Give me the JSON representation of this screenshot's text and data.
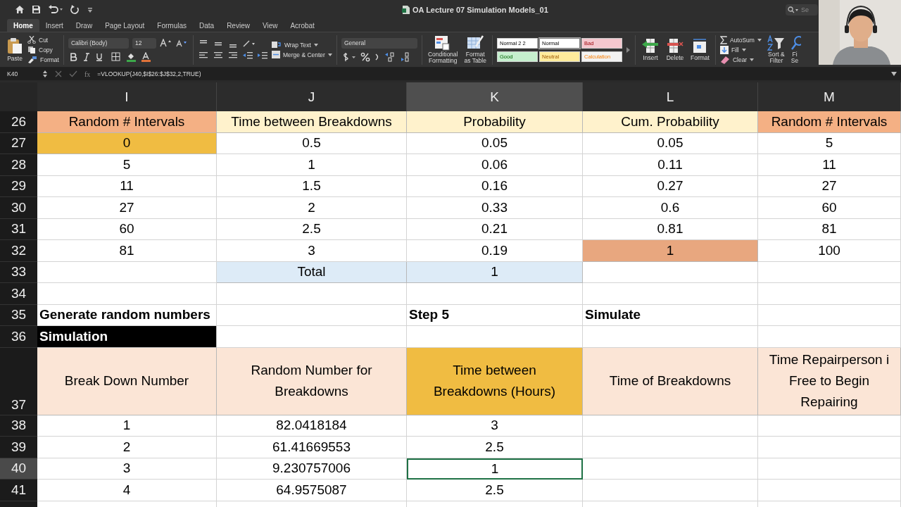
{
  "window": {
    "title": "OA Lecture 07 Simulation Models_01",
    "search_placeholder": "Se"
  },
  "tabs": [
    {
      "label": "Home",
      "selected": true
    },
    {
      "label": "Insert",
      "selected": false
    },
    {
      "label": "Draw",
      "selected": false
    },
    {
      "label": "Page Layout",
      "selected": false
    },
    {
      "label": "Formulas",
      "selected": false
    },
    {
      "label": "Data",
      "selected": false
    },
    {
      "label": "Review",
      "selected": false
    },
    {
      "label": "View",
      "selected": false
    },
    {
      "label": "Acrobat",
      "selected": false
    }
  ],
  "ribbon": {
    "paste": "Paste",
    "clipboard": [
      "Cut",
      "Copy",
      "Format"
    ],
    "font_family": "Calibri (Body)",
    "font_size": "12",
    "wrap": "Wrap Text",
    "merge": "Merge & Center",
    "number_format": "General",
    "format_buttons": [
      "Conditional\nFormatting",
      "Format\nas Table"
    ],
    "cell_styles": [
      {
        "label": "Normal 2 2",
        "kind": "normal",
        "color": "#ffffff",
        "selected": false
      },
      {
        "label": "Normal",
        "kind": "normal",
        "color": "#ffffff",
        "selected": true
      },
      {
        "label": "Bad",
        "kind": "bad",
        "color": "#f4c7ce",
        "selected": false
      },
      {
        "label": "Good",
        "kind": "good",
        "color": "#c6efce",
        "selected": false
      },
      {
        "label": "Neutral",
        "kind": "neutral",
        "color": "#ffeb9c",
        "selected": false
      },
      {
        "label": "Calculation",
        "kind": "calc",
        "color": "#f2f2f2",
        "selected": false
      }
    ],
    "cells": [
      "Insert",
      "Delete",
      "Format"
    ],
    "autosum": "AutoSum",
    "fill": "Fill",
    "clear": "Clear",
    "sort": "Sort &\nFilter",
    "find": "Fi\nSe"
  },
  "formula_bar": {
    "name_box": "K40",
    "fx": "fx",
    "formula": "=VLOOKUP(J40,$I$26:$J$32,2,TRUE)"
  },
  "columns": [
    {
      "label": "I",
      "selected": false
    },
    {
      "label": "J",
      "selected": false
    },
    {
      "label": "K",
      "selected": true
    },
    {
      "label": "L",
      "selected": false
    },
    {
      "label": "M",
      "selected": false
    }
  ],
  "rows": [
    {
      "number": "26",
      "selected": false,
      "cells": [
        {
          "text": "Random # Intervals",
          "color": "#f4b084"
        },
        {
          "text": "Time between Breakdowns",
          "color": "#fff2cc"
        },
        {
          "text": "Probability",
          "color": "#fff2cc"
        },
        {
          "text": "Cum. Probability",
          "color": "#fff2cc"
        },
        {
          "text": "Random # Intervals",
          "color": "#f4b084"
        }
      ]
    },
    {
      "number": "27",
      "selected": false,
      "cells": [
        {
          "text": "0",
          "color": "#f0bc42"
        },
        {
          "text": "0.5"
        },
        {
          "text": "0.05"
        },
        {
          "text": "0.05"
        },
        {
          "text": "5"
        }
      ]
    },
    {
      "number": "28",
      "selected": false,
      "cells": [
        {
          "text": "5"
        },
        {
          "text": "1"
        },
        {
          "text": "0.06"
        },
        {
          "text": "0.11"
        },
        {
          "text": "11"
        }
      ]
    },
    {
      "number": "29",
      "selected": false,
      "cells": [
        {
          "text": "11"
        },
        {
          "text": "1.5"
        },
        {
          "text": "0.16"
        },
        {
          "text": "0.27"
        },
        {
          "text": "27"
        }
      ]
    },
    {
      "number": "30",
      "selected": false,
      "cells": [
        {
          "text": "27"
        },
        {
          "text": "2"
        },
        {
          "text": "0.33"
        },
        {
          "text": "0.6"
        },
        {
          "text": "60"
        }
      ]
    },
    {
      "number": "31",
      "selected": false,
      "cells": [
        {
          "text": "60"
        },
        {
          "text": "2.5"
        },
        {
          "text": "0.21"
        },
        {
          "text": "0.81"
        },
        {
          "text": "81"
        }
      ]
    },
    {
      "number": "32",
      "selected": false,
      "cells": [
        {
          "text": "81"
        },
        {
          "text": "3"
        },
        {
          "text": "0.19"
        },
        {
          "text": "1",
          "color": "#e8a77f"
        },
        {
          "text": "100"
        }
      ]
    },
    {
      "number": "33",
      "selected": false,
      "cells": [
        {},
        {
          "text": "Total",
          "color": "#ddebf7"
        },
        {
          "text": "1",
          "color": "#ddebf7"
        },
        {},
        {}
      ]
    },
    {
      "number": "34",
      "selected": false,
      "cells": [
        {},
        {},
        {},
        {},
        {}
      ]
    },
    {
      "number": "35",
      "selected": false,
      "cells": [
        {
          "text": "Generate random numbers",
          "kind": "label"
        },
        {},
        {
          "text": "Step 5",
          "kind": "label"
        },
        {
          "text": "Simulate",
          "kind": "label"
        },
        {}
      ]
    },
    {
      "number": "36",
      "selected": false,
      "cells": [
        {
          "text": "Simulation",
          "kind": "label",
          "color": "#000000"
        },
        {},
        {},
        {},
        {}
      ]
    },
    {
      "number": "37",
      "selected": false,
      "cells": [
        {
          "text": "Break Down Number",
          "color": "#fbe5d6"
        },
        {
          "text": "Random Number for\nBreakdowns",
          "color": "#fbe5d6"
        },
        {
          "text": "Time between\nBreakdowns (Hours)",
          "color": "#f0bc42"
        },
        {
          "text": "Time of Breakdowns",
          "color": "#fbe5d6"
        },
        {
          "text": "Time Repairperson i\nFree to Begin\nRepairing",
          "color": "#fbe5d6"
        }
      ]
    },
    {
      "number": "38",
      "selected": false,
      "cells": [
        {
          "text": "1"
        },
        {
          "text": "82.0418184"
        },
        {
          "text": "3"
        },
        {},
        {}
      ]
    },
    {
      "number": "39",
      "selected": false,
      "cells": [
        {
          "text": "2"
        },
        {
          "text": "61.41669553"
        },
        {
          "text": "2.5"
        },
        {},
        {}
      ]
    },
    {
      "number": "40",
      "selected": true,
      "cells": [
        {
          "text": "3"
        },
        {
          "text": "9.230757006"
        },
        {
          "text": "1",
          "selected": true
        },
        {},
        {}
      ]
    },
    {
      "number": "41",
      "selected": false,
      "cells": [
        {
          "text": "4"
        },
        {
          "text": "64.9575087"
        },
        {
          "text": "2.5"
        },
        {},
        {}
      ]
    }
  ]
}
